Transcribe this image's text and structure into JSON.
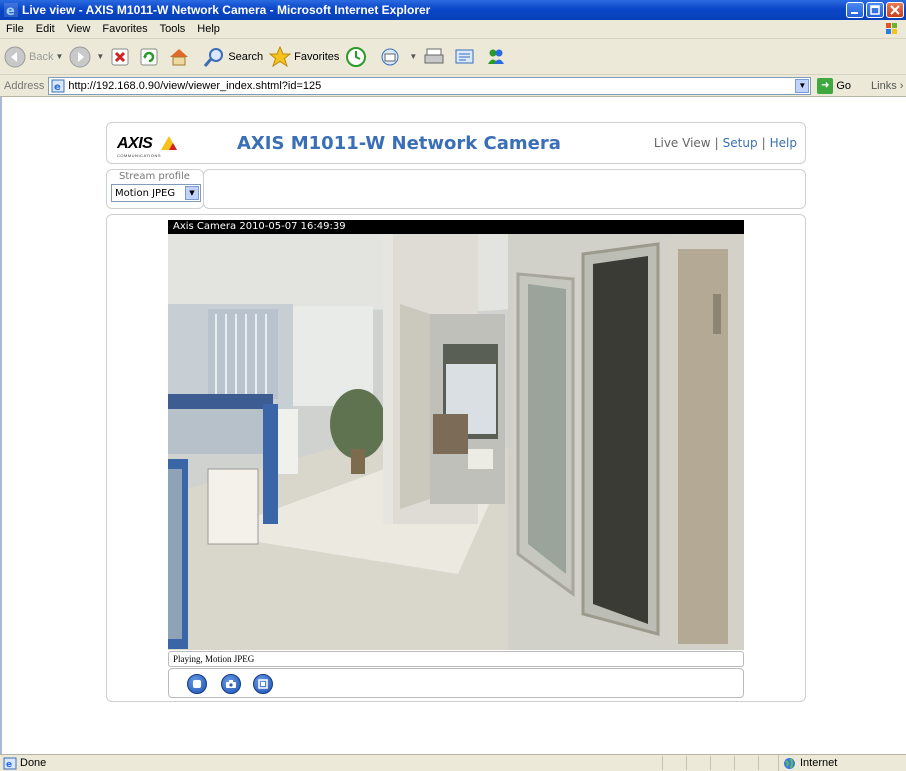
{
  "window": {
    "title": "Live view - AXIS M1011-W Network Camera - Microsoft Internet Explorer"
  },
  "menu": [
    "File",
    "Edit",
    "View",
    "Favorites",
    "Tools",
    "Help"
  ],
  "toolbar": {
    "back_label": "Back",
    "search_label": "Search",
    "favorites_label": "Favorites"
  },
  "address": {
    "label": "Address",
    "url": "http://192.168.0.90/view/viewer_index.shtml?id=125",
    "go_label": "Go",
    "links_label": "Links"
  },
  "page": {
    "logo_text": "AXIS",
    "logo_subtext": "COMMUNICATIONS",
    "camera_title": "AXIS M1011-W Network Camera",
    "nav": {
      "live_view": "Live View",
      "sep1": "|",
      "setup": "Setup",
      "sep2": "|",
      "help": "Help"
    },
    "stream_profile": {
      "label": "Stream profile",
      "value": "Motion JPEG"
    },
    "video": {
      "overlay_text": "Axis Camera 2010-05-07 16:49:39",
      "status_text": "Playing, Motion JPEG"
    }
  },
  "statusbar": {
    "status": "Done",
    "zone": "Internet"
  },
  "colors": {
    "title_blue": "#3a6fb8",
    "xp_title": "#0a46c8",
    "chrome": "#ece9d8"
  },
  "icons": [
    "ie-logo-icon",
    "minimize-icon",
    "maximize-icon",
    "close-icon",
    "windows-flag-icon",
    "back-icon",
    "forward-icon",
    "stop-icon",
    "refresh-icon",
    "home-icon",
    "search-icon",
    "favorites-star-icon",
    "history-icon",
    "mail-icon",
    "print-icon",
    "edit-icon",
    "messenger-icon",
    "page-icon",
    "go-arrow-icon",
    "stop-video-icon",
    "snapshot-icon",
    "fullscreen-icon",
    "globe-icon"
  ]
}
